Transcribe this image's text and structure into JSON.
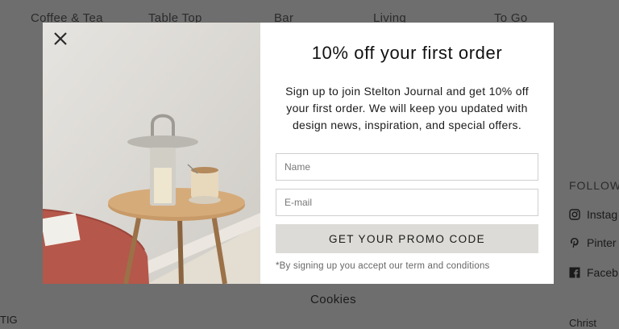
{
  "background": {
    "nav": [
      "Coffee & Tea",
      "Table Top",
      "Bar",
      "Living",
      "To Go"
    ],
    "follow_label": "FOLLOW",
    "social": [
      "Instag",
      "Pinter",
      "Faceb"
    ],
    "cookies_link": "Cookies",
    "left_fragment": "TIG",
    "right_fragment": "Christ"
  },
  "modal": {
    "title": "10% off your first order",
    "description": "Sign up to join Stelton Journal and get 10% off your first order. We will keep you updated with design news, inspiration, and special offers.",
    "name_placeholder": "Name",
    "email_placeholder": "E-mail",
    "submit_label": "GET YOUR PROMO CODE",
    "terms": "*By signing up you accept our term and conditions",
    "close_icon": "close-icon"
  },
  "colors": {
    "overlay": "#6e6e6e",
    "button_bg": "#dcdbd7",
    "wall": "#d9d6d1",
    "chair": "#b5574a",
    "table_wood": "#c79a68"
  }
}
